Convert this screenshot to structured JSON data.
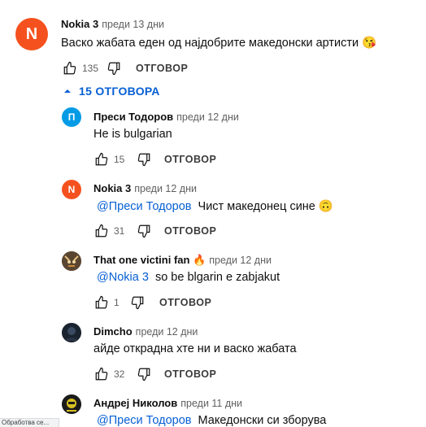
{
  "top_comment": {
    "avatar_letter": "N",
    "avatar_color": "#f4511e",
    "author": "Nokia 3",
    "date": "преди 13 дни",
    "text": "Васко жабата еден од најдобрите македонски артисти 😘",
    "likes": "135",
    "reply_label": "ОТГОВОР"
  },
  "replies_toggle": {
    "label": "15 ОТГОВОРА",
    "icon": "caret-up-icon"
  },
  "replies": [
    {
      "avatar_letter": "П",
      "avatar_color": "#039be5",
      "author": "Преси Тодоров",
      "date": "преди 12 дни",
      "mention": "",
      "text": "He is bulgarian",
      "likes": "15",
      "reply_label": "ОТГОВОР"
    },
    {
      "avatar_letter": "N",
      "avatar_color": "#f4511e",
      "author": "Nokia 3",
      "date": "преди 12 дни",
      "mention": "@Преси Тодоров",
      "text": "Чист македонец сине 🙃",
      "likes": "31",
      "reply_label": "ОТГОВОР"
    },
    {
      "avatar_letter": "",
      "avatar_color": "#4a3a2a",
      "author": "That one victini fan 🔥",
      "date": "преди 12 дни",
      "mention": "@Nokia 3",
      "text": "so be blgarin e zabjakut",
      "likes": "1",
      "reply_label": "ОТГОВОР"
    },
    {
      "avatar_letter": "",
      "avatar_color": "#1a2430",
      "author": "Dimcho",
      "date": "преди 12 дни",
      "mention": "",
      "text": "айде открадна хте ни и васко жабата",
      "likes": "32",
      "reply_label": "ОТГОВОР"
    },
    {
      "avatar_letter": "",
      "avatar_color": "#1b1b1b",
      "author": "Андреј Николов",
      "date": "преди 11 дни",
      "mention": "@Преси Тодоров",
      "text": "Македонски си зборува",
      "likes": "",
      "reply_label": ""
    }
  ],
  "status_text": "Обработва се..."
}
